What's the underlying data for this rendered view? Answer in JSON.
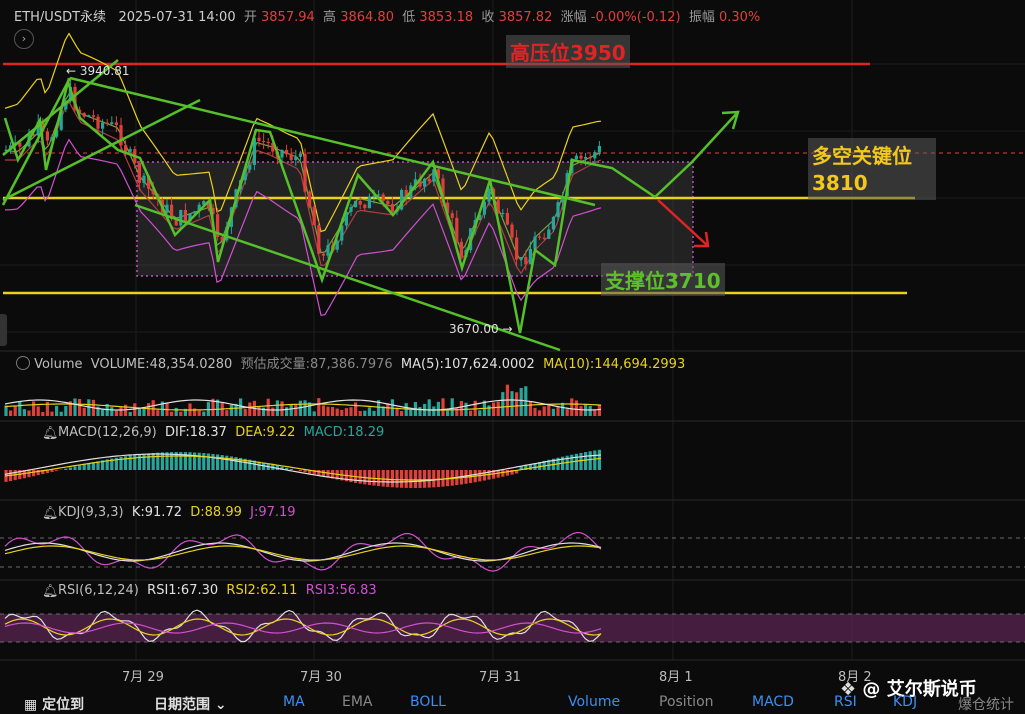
{
  "header": {
    "symbol": "ETH/USDT永续",
    "datetime": "2025-07-31 14:00",
    "open_label": "开",
    "open": "3857.94",
    "high_label": "高",
    "high": "3864.80",
    "low_label": "低",
    "low": "3853.18",
    "close_label": "收",
    "close": "3857.82",
    "change_label": "涨幅",
    "change": "-0.00%(-0.12)",
    "amp_label": "振幅",
    "amp": "0.30%"
  },
  "annotations": {
    "resistance": "高压位3950",
    "key_level_line1": "多空关键位",
    "key_level_line2": "3810",
    "support": "支撑位3710",
    "high_marker": "← 3940.81",
    "low_marker": "3670.00 →"
  },
  "volume": {
    "title": "Volume",
    "volume": "VOLUME:48,354.0280",
    "est": "预估成交量:87,386.7976",
    "ma5": "MA(5):107,624.0002",
    "ma10": "MA(10):144,694.2993"
  },
  "macd": {
    "title": "MACD(12,26,9)",
    "dif": "DIF:18.37",
    "dea": "DEA:9.22",
    "macd": "MACD:18.29"
  },
  "kdj": {
    "title": "KDJ(9,3,3)",
    "k": "K:91.72",
    "d": "D:88.99",
    "j": "J:97.19"
  },
  "rsi": {
    "title": "RSI(6,12,24)",
    "rsi1": "RSI1:67.30",
    "rsi2": "RSI2:62.11",
    "rsi3": "RSI3:56.83"
  },
  "x_axis": [
    "7月 29",
    "7月 30",
    "7月 31",
    "8月 1",
    "8月 2"
  ],
  "watermark": "@ 艾尔斯说币",
  "bottom_tabs": [
    "定位到",
    "日期范围",
    "MA",
    "EMA",
    "BOLL",
    "Volume",
    "Position",
    "MACD",
    "RSI",
    "KDJ",
    "爆仓统计"
  ],
  "colors": {
    "up": "#26a69a",
    "down": "#e0403a",
    "trend": "#55c02a",
    "level": "#e8d21a",
    "resistance": "#e02424",
    "box": "#c050c0"
  }
}
